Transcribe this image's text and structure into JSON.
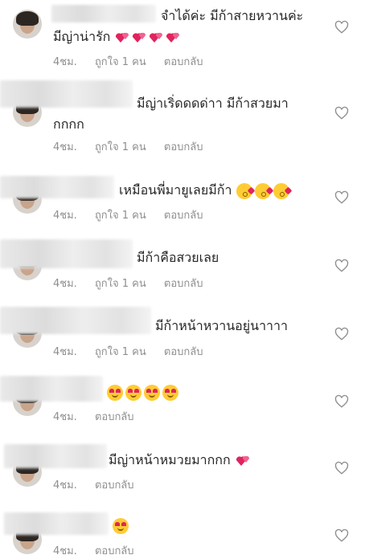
{
  "labels": {
    "reply": "ตอบกลับ",
    "like_one": "ถูกใจ 1 คน"
  },
  "icons": {
    "heart": "heart-icon",
    "avatar": "avatar",
    "emoji_heart_eyes": "heart-eyes-emoji",
    "emoji_kiss": "kiss-face-emoji",
    "emoji_pink_hearts": "two-hearts-emoji"
  },
  "colors": {
    "text": "#262626",
    "meta": "#8e8e8e",
    "emoji_yellow": "#ffcc33",
    "heart_pink": "#e0245e"
  },
  "comments": [
    {
      "text1": "จำได้ค่ะ มีก้าสายหวานค่ะ",
      "text2": "มีญ่าน่ารัก",
      "time": "4ชม.",
      "likes": "ถูกใจ 1 คน"
    },
    {
      "text1": "มีญ่าเริ่ดดดด่าา มีก้าสวยมา",
      "text2": "กกกก",
      "time": "4ชม.",
      "likes": "ถูกใจ 1 คน"
    },
    {
      "text1": "เหมือนพี่มายูเลยมีก้า",
      "time": "4ชม.",
      "likes": "ถูกใจ 1 คน"
    },
    {
      "text1": "มีก้าคือสวยเลย",
      "time": "4ชม.",
      "likes": "ถูกใจ 1 คน"
    },
    {
      "text1": "มีก้าหน้าหวานอยู่นาาาา",
      "time": "4ชม.",
      "likes": "ถูกใจ 1 คน"
    },
    {
      "time": "4ชม."
    },
    {
      "text1": "มีญ่าหน้าหมวยมากกก",
      "time": "4ชม."
    },
    {
      "time": "4ชม."
    }
  ]
}
